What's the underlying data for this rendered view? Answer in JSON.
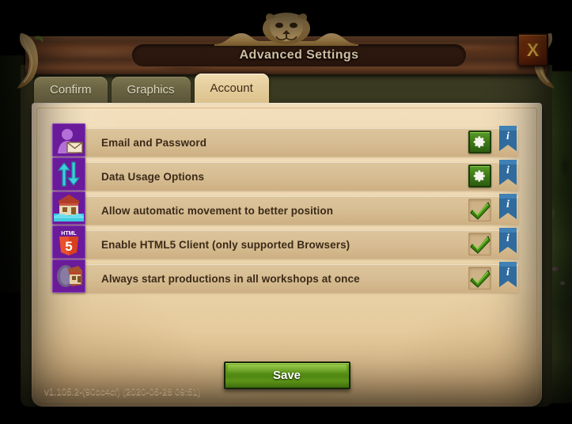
{
  "window": {
    "title": "Advanced Settings",
    "close_label": "X",
    "crest_icon": "lion-head-crest-icon"
  },
  "tabs": [
    {
      "label": "Confirm",
      "active": false,
      "name": "tab-confirm"
    },
    {
      "label": "Graphics",
      "active": false,
      "name": "tab-graphics"
    },
    {
      "label": "Account",
      "active": true,
      "name": "tab-account"
    }
  ],
  "settings": {
    "rows": [
      {
        "label": "Email and Password",
        "icon": "user-envelope-icon",
        "control": "gear",
        "control_icon": "gear-icon",
        "info_icon": "info-ribbon-icon",
        "name": "setting-email-and-password"
      },
      {
        "label": "Data Usage Options",
        "icon": "data-transfer-arrows-icon",
        "control": "gear",
        "control_icon": "gear-icon",
        "info_icon": "info-ribbon-icon",
        "name": "setting-data-usage-options"
      },
      {
        "label": "Allow automatic movement to better position",
        "icon": "house-building-icon",
        "control": "checkbox",
        "control_icon": "check-icon",
        "checked": true,
        "info_icon": "info-ribbon-icon",
        "name": "setting-allow-automatic-movement"
      },
      {
        "label": "Enable HTML5 Client (only supported Browsers)",
        "icon": "html5-shield-icon",
        "control": "checkbox",
        "control_icon": "check-icon",
        "checked": true,
        "info_icon": "info-ribbon-icon",
        "name": "setting-enable-html5-client"
      },
      {
        "label": "Always start productions in all workshops at once",
        "icon": "workshop-building-icon",
        "control": "checkbox",
        "control_icon": "check-icon",
        "checked": true,
        "info_icon": "info-ribbon-icon",
        "name": "setting-always-start-productions"
      }
    ]
  },
  "footer": {
    "save_label": "Save",
    "version": "v1.105.2-(90bc4cf) (2020-05-28 09:51)"
  },
  "colors": {
    "accent_green": "#4f8712",
    "info_blue": "#2f6b9e",
    "parchment": "#eed9b2",
    "wood": "#5d3a23",
    "gold": "#ffc64a",
    "icon_purple": "#6a1b9a"
  }
}
